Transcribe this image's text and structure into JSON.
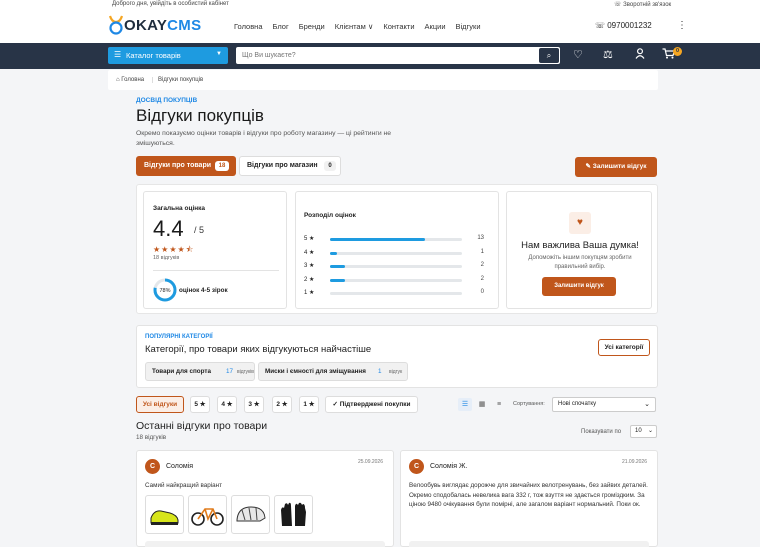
{
  "topbar": {
    "greeting": "Доброго дня, увійдіть в особистий кабінет",
    "callback": "Зворотній зв'язок"
  },
  "logo": {
    "okay": "OKAY",
    "cms": "CMS"
  },
  "nav": [
    "Головна",
    "Блог",
    "Бренди",
    "Клієнтам ∨",
    "Контакти",
    "Акции",
    "Відгуки"
  ],
  "phone": "0970001232",
  "catalog_label": "Каталог товарів",
  "search": {
    "placeholder": "Що Ви шукаєте?"
  },
  "cart_count": "0",
  "breadcrumb": {
    "home": "Головна",
    "current": "Відгуки покупців"
  },
  "page": {
    "eyebrow": "ДОСВІД ПОКУПЦІВ",
    "title": "Відгуки покупців",
    "desc": "Окремо показуємо оцінки товарів і відгуки про роботу магазину — ці рейтинги не змішуються."
  },
  "tabs": {
    "products": {
      "label": "Відгуки про товари",
      "count": "18"
    },
    "store": {
      "label": "Відгуки про магазин",
      "count": "0"
    }
  },
  "write_review_label": "Залишити відгук",
  "overall": {
    "label": "Загальна оцінка",
    "score": "4.4",
    "outof": "/ 5",
    "stars": "★★★★⯪",
    "count_text": "18 відгуків",
    "ring_value": 0.78,
    "ring_text": "78%",
    "ring_label": "оцінок 4-5 зірок"
  },
  "distribution": {
    "label": "Розподіл оцінок",
    "rows": [
      {
        "star": "5 ★",
        "count": 13,
        "label": "13"
      },
      {
        "star": "4 ★",
        "count": 1,
        "label": "1"
      },
      {
        "star": "3 ★",
        "count": 2,
        "label": "2"
      },
      {
        "star": "2 ★",
        "count": 2,
        "label": "2"
      },
      {
        "star": "1 ★",
        "count": 0,
        "label": "0"
      }
    ],
    "max": 18
  },
  "cta": {
    "title": "Нам важлива Ваша думка!",
    "desc": "Допоможіть іншим покупцям зробити правильний вибір.",
    "button": "Залишити відгук"
  },
  "popular": {
    "eyebrow": "ПОПУЛЯРНІ КАТЕГОРІЇ",
    "title": "Категорії, про товари яких відгукуються найчастіше",
    "all_label": "Усі категорії",
    "chips": [
      {
        "name": "Товари для спорта",
        "count": "17",
        "unit": "відгуків"
      },
      {
        "name": "Миски і ємності для зміщування",
        "count": "1",
        "unit": "відгук"
      }
    ]
  },
  "filters": {
    "all": "Усі відгуки",
    "stars": [
      "5 ★",
      "4 ★",
      "3 ★",
      "2 ★",
      "1 ★"
    ],
    "verified": "✓ Підтверджені покупки",
    "sort_label": "Сортування:",
    "sort_value": "Нові спочатку"
  },
  "latest": {
    "title": "Останні відгуки про товари",
    "count": "18 відгуків",
    "show_label": "Показувати по",
    "show_value": "10"
  },
  "reviews": [
    {
      "initial": "С",
      "name": "Соломія",
      "date": "25.09.2026",
      "text": "Самий найкращий варіант"
    },
    {
      "initial": "С",
      "name": "Соломія Ж.",
      "date": "21.09.2026",
      "text": "Велообувь виглядає дорожче для звичайних велотренувань, без зайвих деталей. Окремо сподобалась невелика вага 332 г, тож взуття не здається громіздким. За ціною 9480 очікування були помірні, але загалом варіант нормальний. Поки ок."
    }
  ]
}
